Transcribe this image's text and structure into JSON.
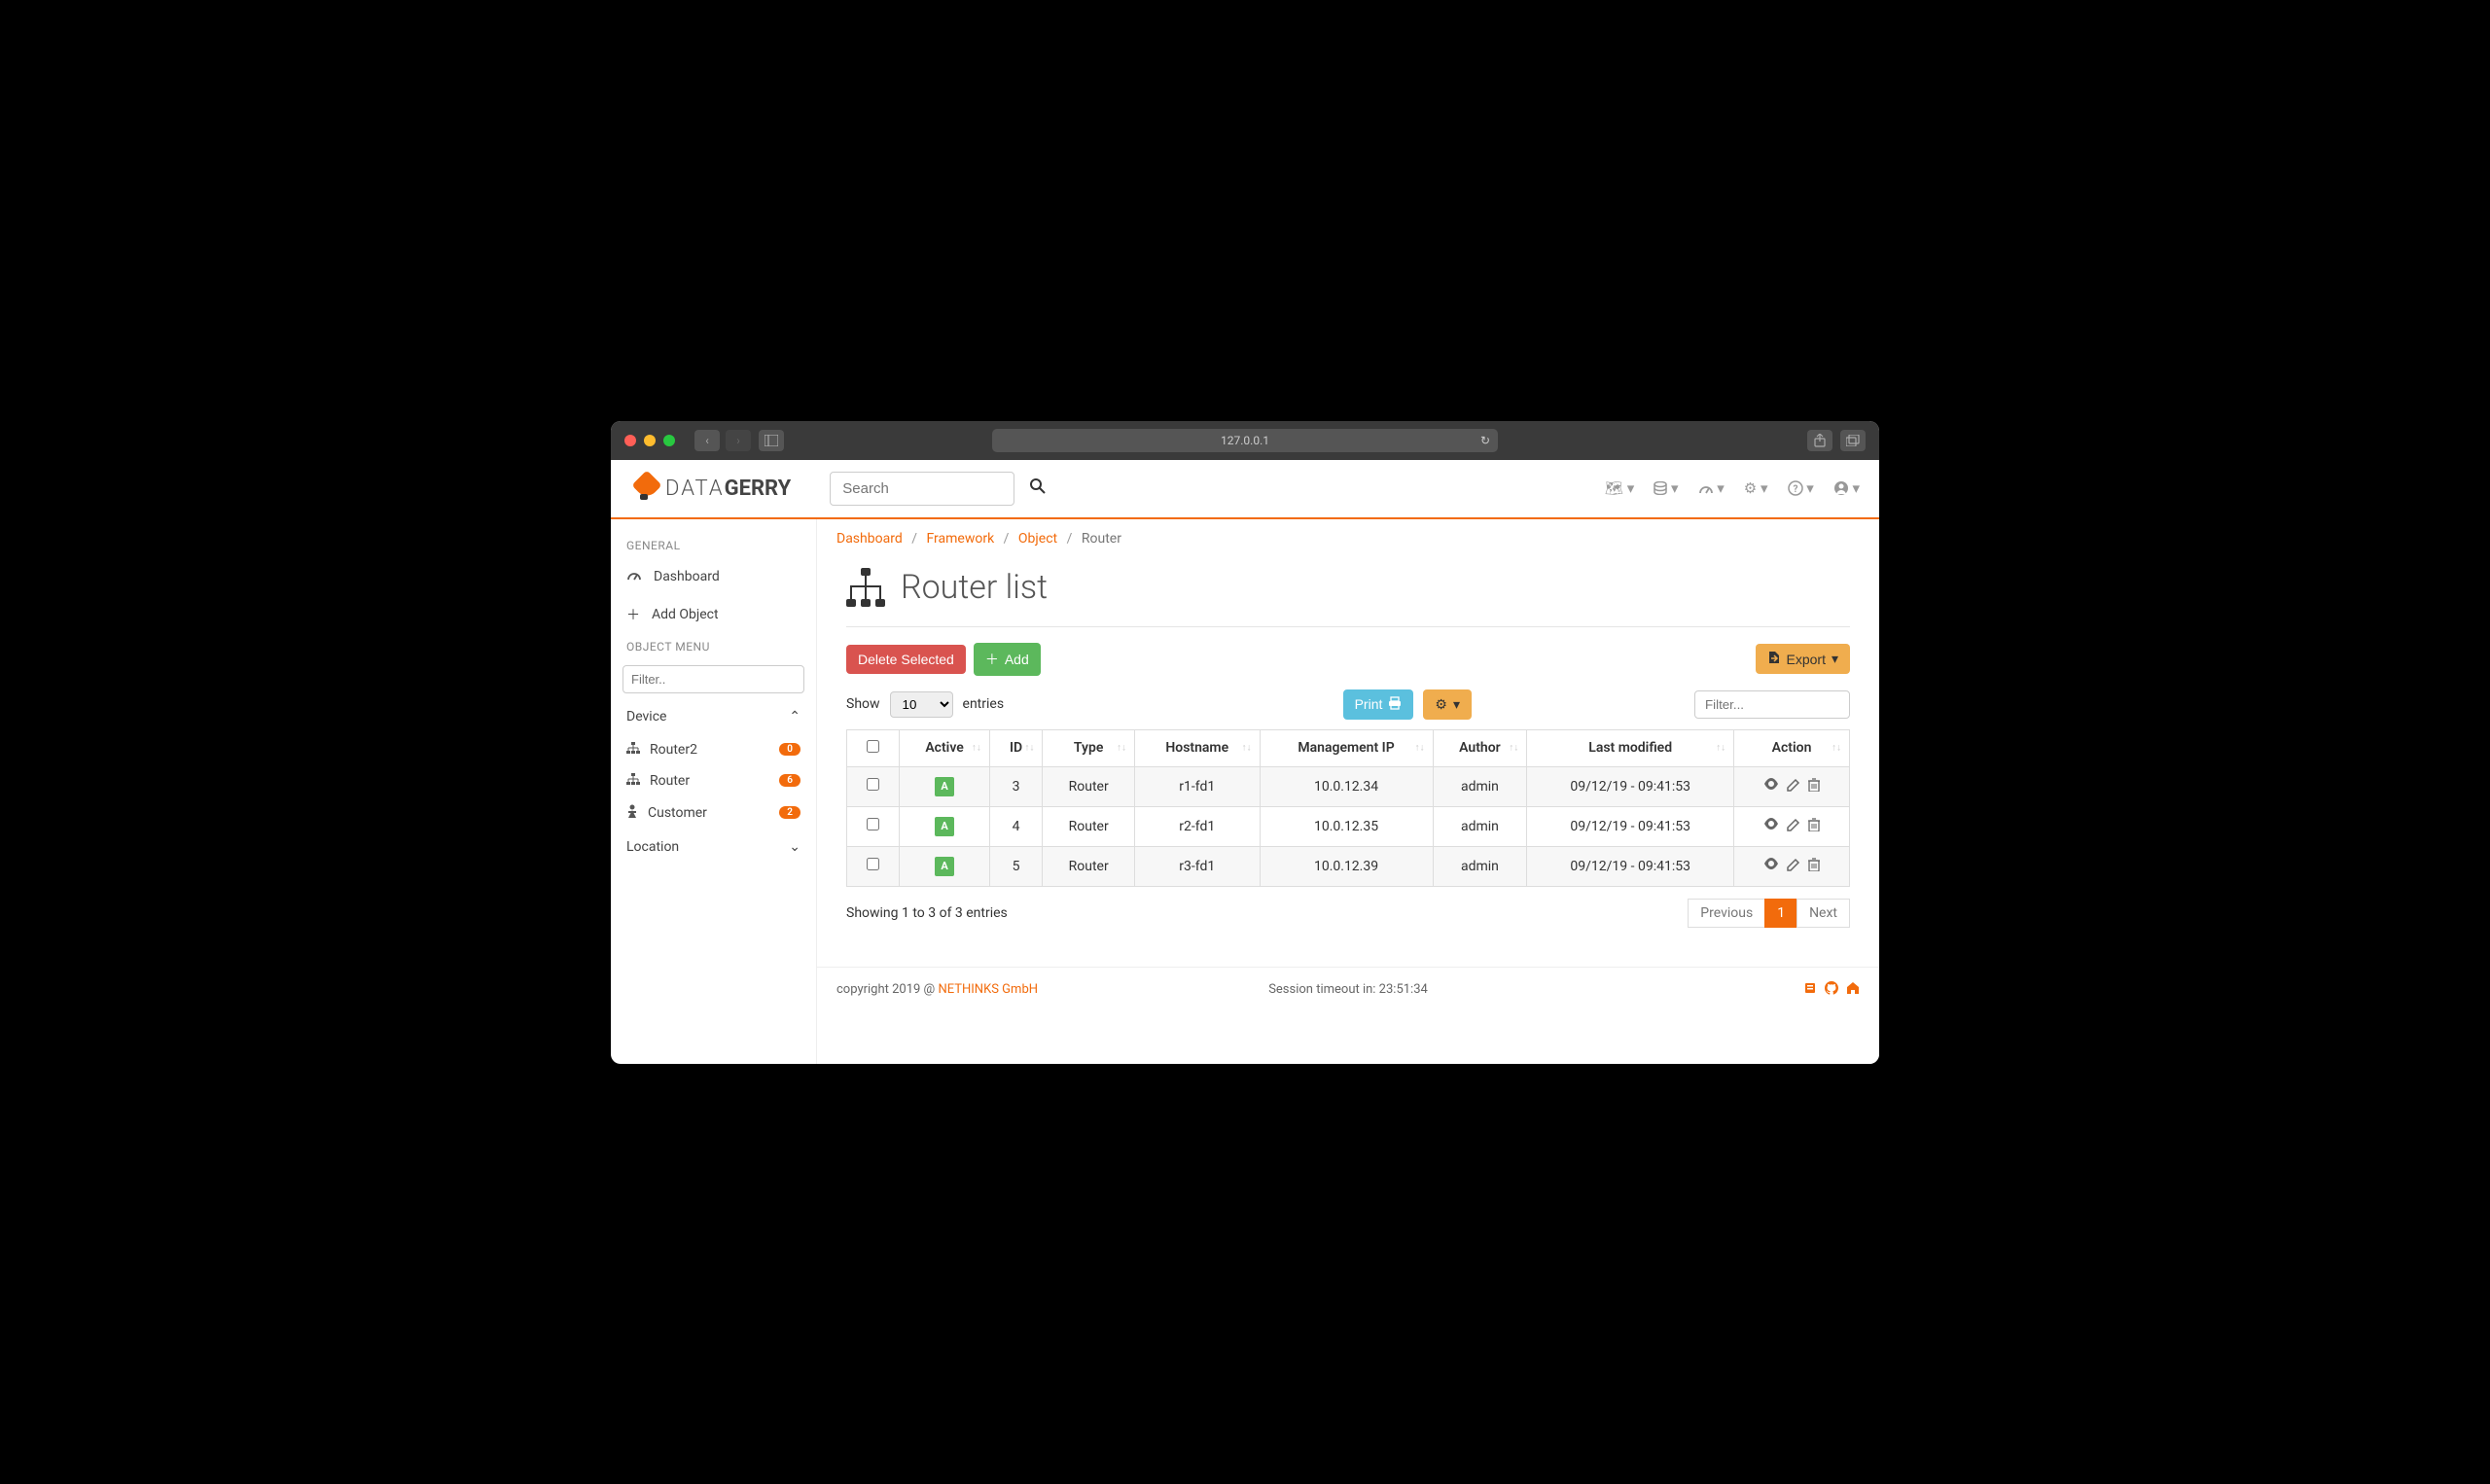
{
  "browser": {
    "url": "127.0.0.1"
  },
  "header": {
    "search_placeholder": "Search",
    "logo_d": "DATA",
    "logo_g": "GERRY"
  },
  "sidebar": {
    "general_label": "GENERAL",
    "dashboard": "Dashboard",
    "add_object": "Add Object",
    "objmenu_label": "OBJECT MENU",
    "filter_placeholder": "Filter..",
    "device": "Device",
    "router2": {
      "label": "Router2",
      "count": "0"
    },
    "router": {
      "label": "Router",
      "count": "6"
    },
    "customer": {
      "label": "Customer",
      "count": "2"
    },
    "location": "Location"
  },
  "breadcrumb": {
    "dashboard": "Dashboard",
    "framework": "Framework",
    "object": "Object",
    "current": "Router"
  },
  "page": {
    "title": "Router list",
    "delete_btn": "Delete Selected",
    "add_btn": "Add",
    "export_btn": "Export",
    "show_label": "Show",
    "entries_label": "entries",
    "page_size": "10",
    "print_btn": "Print",
    "filter_placeholder": "Filter...",
    "showing": "Showing 1 to 3 of 3 entries",
    "prev": "Previous",
    "next": "Next",
    "page_num": "1"
  },
  "table": {
    "headers": {
      "active": "Active",
      "id": "ID",
      "type": "Type",
      "hostname": "Hostname",
      "mgmt": "Management IP",
      "author": "Author",
      "modified": "Last modified",
      "action": "Action"
    },
    "rows": [
      {
        "active": "A",
        "id": "3",
        "type": "Router",
        "hostname": "r1-fd1",
        "mgmt": "10.0.12.34",
        "author": "admin",
        "modified": "09/12/19 - 09:41:53"
      },
      {
        "active": "A",
        "id": "4",
        "type": "Router",
        "hostname": "r2-fd1",
        "mgmt": "10.0.12.35",
        "author": "admin",
        "modified": "09/12/19 - 09:41:53"
      },
      {
        "active": "A",
        "id": "5",
        "type": "Router",
        "hostname": "r3-fd1",
        "mgmt": "10.0.12.39",
        "author": "admin",
        "modified": "09/12/19 - 09:41:53"
      }
    ]
  },
  "footer": {
    "copyright": "copyright 2019 @ ",
    "company": "NETHINKS GmbH",
    "session": "Session timeout in: 23:51:34"
  }
}
